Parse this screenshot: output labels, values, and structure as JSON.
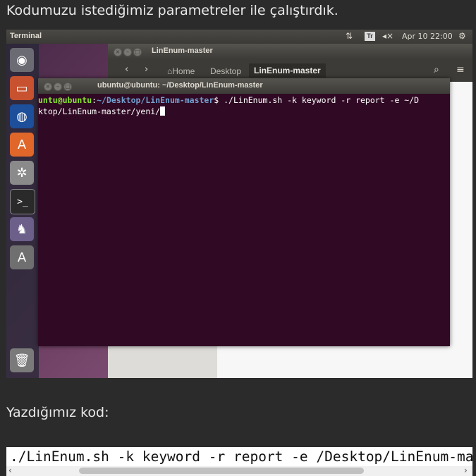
{
  "intro_text": "Kodumuzu istediğimiz parametreler ile çalıştırdık.",
  "screenshot": {
    "topbar": {
      "title": "Terminal",
      "network_icon": "⇅",
      "keyboard_badge": "Tr",
      "volume_icon": "◂×",
      "clock": "Apr 10 22:00",
      "settings_icon": "⚙"
    },
    "launcher": {
      "items": [
        "ubuntu-dash",
        "files",
        "firefox",
        "software-center",
        "system-settings",
        "terminal",
        "app-icon",
        "software-updater",
        "trash"
      ]
    },
    "file_manager": {
      "title": "LinEnum-master",
      "back": "‹",
      "forward": "›",
      "breadcrumbs": [
        "Home",
        "Desktop",
        "LinEnum-master"
      ],
      "home_icon": "⌂",
      "search_icon": "⌕",
      "menu_icon": "≡"
    },
    "terminal": {
      "title": "ubuntu@ubuntu: ~/Desktop/LinEnum-master",
      "prompt_user": "untu@ubuntu",
      "prompt_sep": ":",
      "prompt_path": "~/Desktop/LinEnum-master",
      "command": "$ ./LinEnum.sh -k keyword -r report -e ~/D",
      "line2": "ktop/LinEnum-master/yeni/"
    }
  },
  "code_label": "Yazdığımız kod:",
  "code_text": "./LinEnum.sh -k keyword -r report -e /Desktop/LinEnum-master/yeni/",
  "scroll": {
    "left": "‹",
    "right": "›"
  },
  "colors": {
    "page_bg": "#2b2b2b",
    "terminal_bg": "#300a24",
    "prompt_user": "#8ae234",
    "prompt_path": "#729fcf"
  }
}
